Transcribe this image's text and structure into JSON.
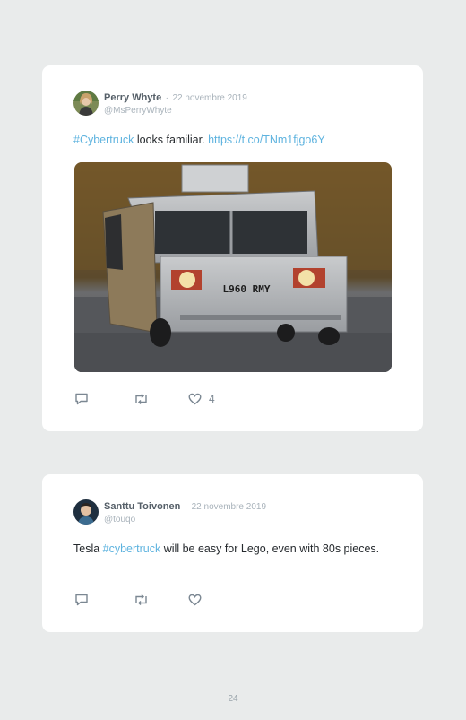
{
  "tweets": [
    {
      "author": "Perry Whyte",
      "separator": "·",
      "date": "22 novembre 2019",
      "handle": "@MsPerryWhyte",
      "text_hashtag": "#Cybertruck",
      "text_body": " looks familiar. ",
      "text_link": "https://t.co/TNm1fjgo6Y",
      "image_plate": "L960 RMY",
      "likes": "4"
    },
    {
      "author": "Santtu Toivonen",
      "separator": "·",
      "date": "22 novembre 2019",
      "handle": "@touqo",
      "text_before": "Tesla ",
      "text_hashtag": "#cybertruck",
      "text_after": " will be easy for Lego, even with 80s pieces."
    }
  ],
  "page_number": "24",
  "icons": [
    "reply-icon",
    "retweet-icon",
    "like-icon"
  ],
  "colors": {
    "link": "#5eb3df",
    "background": "#e9ebeb",
    "card": "#ffffff"
  }
}
